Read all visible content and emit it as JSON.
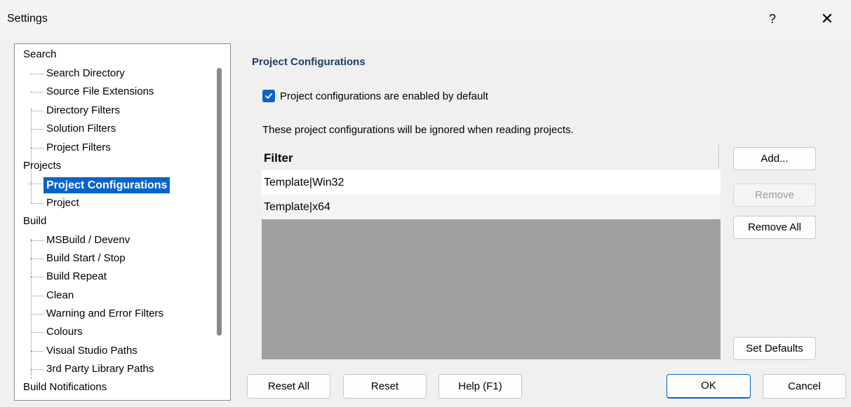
{
  "window": {
    "title": "Settings",
    "help_label": "?",
    "close_label": "✕"
  },
  "tree": {
    "categories": [
      {
        "label": "Search",
        "children": [
          "Search Directory",
          "Source File Extensions",
          "Directory Filters",
          "Solution Filters",
          "Project Filters"
        ]
      },
      {
        "label": "Projects",
        "children": [
          "Project Configurations",
          "Project"
        ]
      },
      {
        "label": "Build",
        "children": [
          "MSBuild / Devenv",
          "Build Start / Stop",
          "Build Repeat",
          "Clean",
          "Warning and Error Filters",
          "Colours",
          "Visual Studio Paths",
          "3rd Party Library Paths"
        ]
      },
      {
        "label": "Build Notifications",
        "children": []
      }
    ],
    "selected": "Project Configurations"
  },
  "panel": {
    "title": "Project Configurations",
    "checkbox_label": "Project configurations are enabled by default",
    "checkbox_checked": true,
    "info_text": "These project configurations will be ignored when reading projects.",
    "grid": {
      "header": "Filter",
      "rows": [
        "Template|Win32",
        "Template|x64"
      ]
    },
    "side_buttons": {
      "add": "Add...",
      "remove": "Remove",
      "remove_all": "Remove All",
      "set_defaults": "Set Defaults"
    }
  },
  "footer": {
    "reset_all": "Reset All",
    "reset": "Reset",
    "help": "Help (F1)",
    "ok": "OK",
    "cancel": "Cancel"
  },
  "colors": {
    "accent": "#0a64c8",
    "section_title": "#1e3c64",
    "grid_empty": "#a0a0a0"
  }
}
